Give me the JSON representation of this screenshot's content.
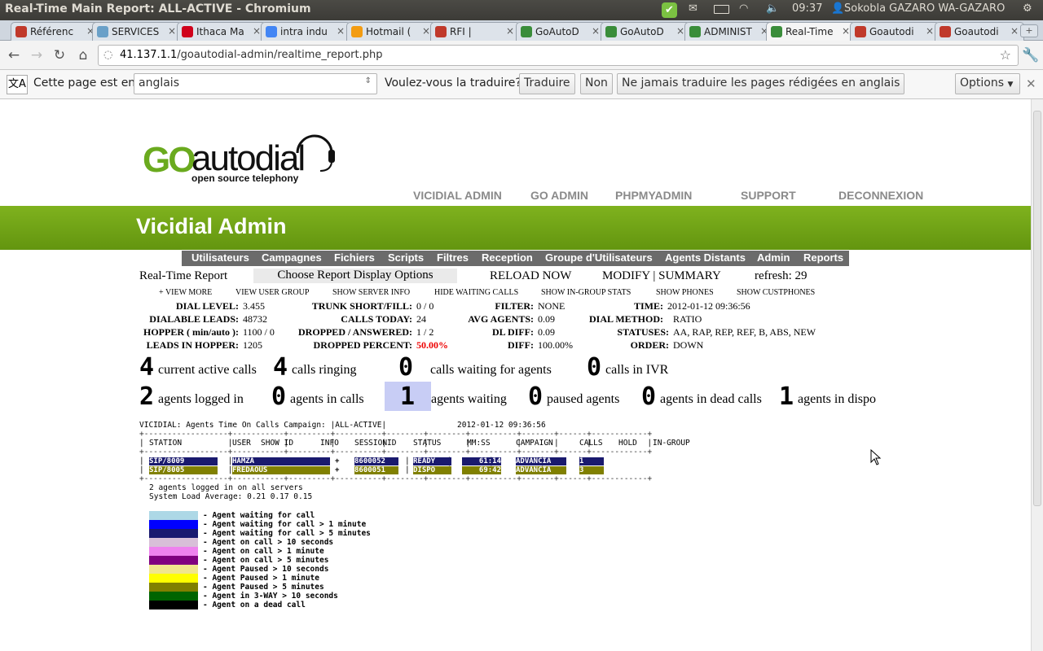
{
  "window": {
    "title": "Real-Time Main Report: ALL-ACTIVE - Chromium",
    "clock": "09:37",
    "user": "Sokobla GAZARO WA-GAZARO"
  },
  "tabs": [
    {
      "label": "Référenc",
      "color": "#c0392b"
    },
    {
      "label": "SERVICES",
      "color": "#6aa0c8"
    },
    {
      "label": "Ithaca Ma",
      "color": "#d0021b"
    },
    {
      "label": "intra indu",
      "color": "#4285f4"
    },
    {
      "label": "Hotmail (",
      "color": "#f39c12"
    },
    {
      "label": "RFI |",
      "color": "#c0392b"
    },
    {
      "label": "GoAutoD",
      "color": "#3a8d3a"
    },
    {
      "label": "GoAutoD",
      "color": "#3a8d3a"
    },
    {
      "label": "ADMINIST",
      "color": "#3a8d3a"
    },
    {
      "label": "Real-Time",
      "color": "#3a8d3a"
    },
    {
      "label": "Goautodi",
      "color": "#c0392b"
    },
    {
      "label": "Goautodi",
      "color": "#c0392b"
    }
  ],
  "url": {
    "host": "41.137.1.1",
    "path": "/goautodial-admin/realtime_report.php"
  },
  "translate": {
    "prompt": "Cette page est en",
    "language": "anglais",
    "question": "Voulez-vous la traduire?",
    "translate_btn": "Traduire",
    "no_btn": "Non",
    "never_btn": "Ne jamais traduire les pages rédigées en anglais",
    "options_btn": "Options"
  },
  "logo": {
    "go": "GO",
    "autodial": "autodial",
    "tagline": "open source telephony"
  },
  "top_links": [
    "VICIDIAL ADMIN",
    "GO ADMIN",
    "PHPMYADMIN",
    "SUPPORT",
    "DECONNEXION"
  ],
  "header_title": "Vicidial Admin",
  "menu": [
    "Utilisateurs",
    "Campagnes",
    "Fichiers",
    "Scripts",
    "Filtres",
    "Reception",
    "Groupe d'Utilisateurs",
    "Agents Distants",
    "Admin",
    "Reports"
  ],
  "report": {
    "title": "Real-Time Report",
    "choose": "Choose Report Display Options",
    "reload": "RELOAD NOW",
    "modify": "MODIFY | SUMMARY",
    "refresh": "refresh: 29",
    "options": [
      "+ VIEW MORE",
      "VIEW USER GROUP",
      "SHOW SERVER INFO",
      "HIDE WAITING CALLS",
      "SHOW IN-GROUP STATS",
      "SHOW PHONES",
      "SHOW CUSTPHONES"
    ]
  },
  "stats": [
    {
      "label": "DIAL LEVEL:",
      "value": "3.455"
    },
    {
      "label": "TRUNK SHORT/FILL:",
      "value": "0 / 0"
    },
    {
      "label": "FILTER:",
      "value": "NONE"
    },
    {
      "label": "TIME:",
      "value": "2012-01-12 09:36:56"
    },
    {
      "label": "DIALABLE LEADS:",
      "value": "48732"
    },
    {
      "label": "CALLS TODAY:",
      "value": "24"
    },
    {
      "label": "AVG AGENTS:",
      "value": "0.09"
    },
    {
      "label": "DIAL METHOD:",
      "value": "RATIO"
    },
    {
      "label": "HOPPER ( min/auto ):",
      "value": "1100 / 0"
    },
    {
      "label": "DROPPED / ANSWERED:",
      "value": "1 / 2"
    },
    {
      "label": "DL DIFF:",
      "value": "0.09"
    },
    {
      "label": "STATUSES:",
      "value": "AA, RAP, REP, REF, B, ABS, NEW"
    },
    {
      "label": "LEADS IN HOPPER:",
      "value": "1205"
    },
    {
      "label": "DROPPED PERCENT:",
      "value": "50.00%"
    },
    {
      "label": "DIFF:",
      "value": "100.00%"
    },
    {
      "label": "ORDER:",
      "value": "DOWN"
    }
  ],
  "counters_row1": [
    {
      "n": "4",
      "t": "current active calls"
    },
    {
      "n": "4",
      "t": "calls ringing"
    },
    {
      "n": "0",
      "t": "calls waiting for agents"
    },
    {
      "n": "0",
      "t": "calls in IVR"
    }
  ],
  "counters_row2": [
    {
      "n": "2",
      "t": "agents logged in"
    },
    {
      "n": "0",
      "t": "agents in calls"
    },
    {
      "n": "1",
      "t": "agents waiting"
    },
    {
      "n": "0",
      "t": "paused agents"
    },
    {
      "n": "0",
      "t": "agents in dead calls"
    },
    {
      "n": "1",
      "t": "agents in dispo"
    }
  ],
  "agents_table": {
    "caption": "VICIDIAL: Agents Time On Calls Campaign: |ALL-ACTIVE|",
    "time": "2012-01-12 09:36:56",
    "headers": [
      "STATION",
      "USER",
      "SHOW ID",
      "INFO",
      "SESSIONID",
      "STATUS",
      "MM:SS",
      "CAMPAIGN",
      "CALLS",
      "HOLD",
      "IN-GROUP"
    ],
    "rows": [
      {
        "station": "SIP/8009",
        "user": "HAMZA",
        "info": "+",
        "session": "8600052",
        "status": "READY",
        "mmss": "61:14",
        "campaign": "ADVANCIA",
        "calls": "1",
        "color": "#1a1a6e",
        "text": "#ffffff"
      },
      {
        "station": "SIP/8005",
        "user": "FREDAOUS",
        "info": "+",
        "session": "8600051",
        "status": "DISPO",
        "mmss": "69:42",
        "campaign": "ADVANCIA",
        "calls": "3",
        "color": "#808000",
        "text": "#ffffff"
      }
    ],
    "footer1": "2 agents logged in on all servers",
    "footer2": "System Load Average: 0.21 0.17 0.15"
  },
  "legend": [
    {
      "color": "#add8e6",
      "label": "- Agent waiting for call"
    },
    {
      "color": "#0000ff",
      "label": "- Agent waiting for call > 1 minute"
    },
    {
      "color": "#191970",
      "label": "- Agent waiting for call > 5 minutes"
    },
    {
      "color": "#d8bfd8",
      "label": "- Agent on call > 10 seconds"
    },
    {
      "color": "#ee82ee",
      "label": "- Agent on call > 1 minute"
    },
    {
      "color": "#800080",
      "label": "- Agent on call > 5 minutes"
    },
    {
      "color": "#f0e68c",
      "label": "- Agent Paused > 10 seconds"
    },
    {
      "color": "#ffff00",
      "label": "- Agent Paused > 1 minute"
    },
    {
      "color": "#808000",
      "label": "- Agent Paused > 5 minutes"
    },
    {
      "color": "#006400",
      "label": "- Agent in 3-WAY > 10 seconds"
    },
    {
      "color": "#000000",
      "label": "- Agent on a dead call"
    }
  ]
}
